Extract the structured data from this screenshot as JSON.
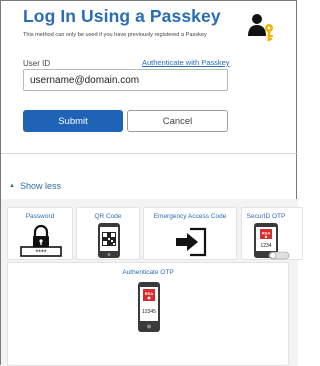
{
  "header": {
    "title": "Log In Using a Passkey",
    "subtitle": "This method can only be used if you have previously registered a Passkey",
    "icon": "user-key-icon"
  },
  "form": {
    "user_id_label": "User ID",
    "authenticate_link": "Authenticate with Passkey",
    "user_id_value": "username@domain.com",
    "submit_label": "Submit",
    "cancel_label": "Cancel"
  },
  "toggle": {
    "label": "Show less"
  },
  "methods": [
    {
      "label": "Password",
      "icon": "padlock-icon"
    },
    {
      "label": "QR Code",
      "icon": "phone-qr-icon"
    },
    {
      "label": "Emergency Access Code",
      "icon": "arrow-into-box-icon"
    },
    {
      "label": "SecurID OTP",
      "icon": "phone-rsa-toggle-icon",
      "code": "1234",
      "badge": "RSA"
    },
    {
      "label": "Authenticate OTP",
      "icon": "phone-rsa-icon",
      "code": "12345",
      "badge": "RSA"
    }
  ],
  "colors": {
    "brand_blue": "#2a6db3",
    "submit_blue": "#1e63b5",
    "rsa_red": "#d92d2d",
    "key_gold": "#f2b705"
  }
}
